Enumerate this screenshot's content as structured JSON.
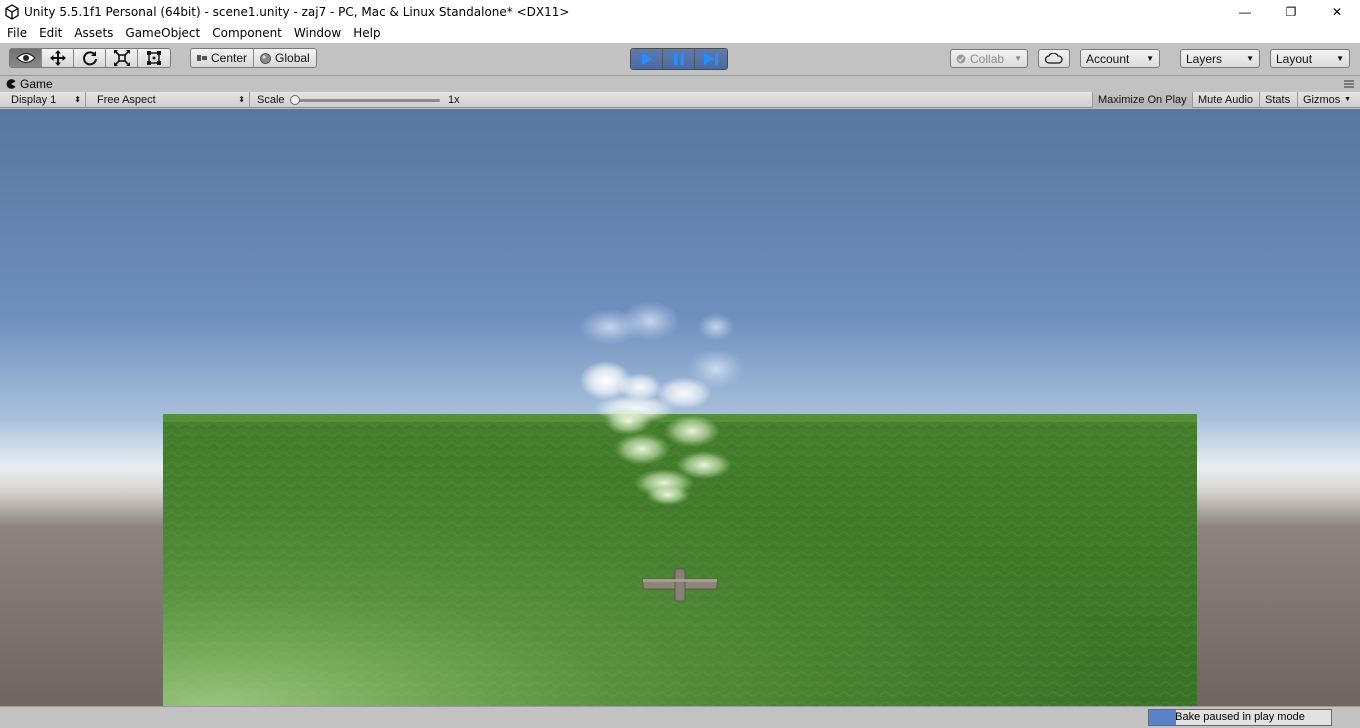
{
  "window": {
    "title": "Unity 5.5.1f1 Personal (64bit) - scene1.unity - zaj7 - PC, Mac & Linux Standalone* <DX11>",
    "minimize": "—",
    "maximize": "❐",
    "close": "✕"
  },
  "menu": [
    "File",
    "Edit",
    "Assets",
    "GameObject",
    "Component",
    "Window",
    "Help"
  ],
  "toolbar": {
    "tools": [
      "view-tool",
      "move-tool",
      "rotate-tool",
      "scale-tool",
      "rect-tool"
    ],
    "pivot_label": "Center",
    "space_label": "Global",
    "collab_label": "Collab",
    "account_label": "Account",
    "layers_label": "Layers",
    "layout_label": "Layout"
  },
  "game_tab": {
    "label": "Game"
  },
  "game_bar": {
    "display": "Display 1",
    "aspect": "Free Aspect",
    "scale_label": "Scale",
    "scale_value": "1x",
    "maximize_on_play": "Maximize On Play",
    "mute_audio": "Mute Audio",
    "stats": "Stats",
    "gizmos": "Gizmos"
  },
  "status": {
    "bake_label": "Bake paused in play mode",
    "bake_progress": 0.15
  },
  "colors": {
    "play_active": "#4a6aa0",
    "progress_fill": "#5a82c8",
    "sky_top": "#5876a0",
    "grass": "#3e7a2a"
  }
}
